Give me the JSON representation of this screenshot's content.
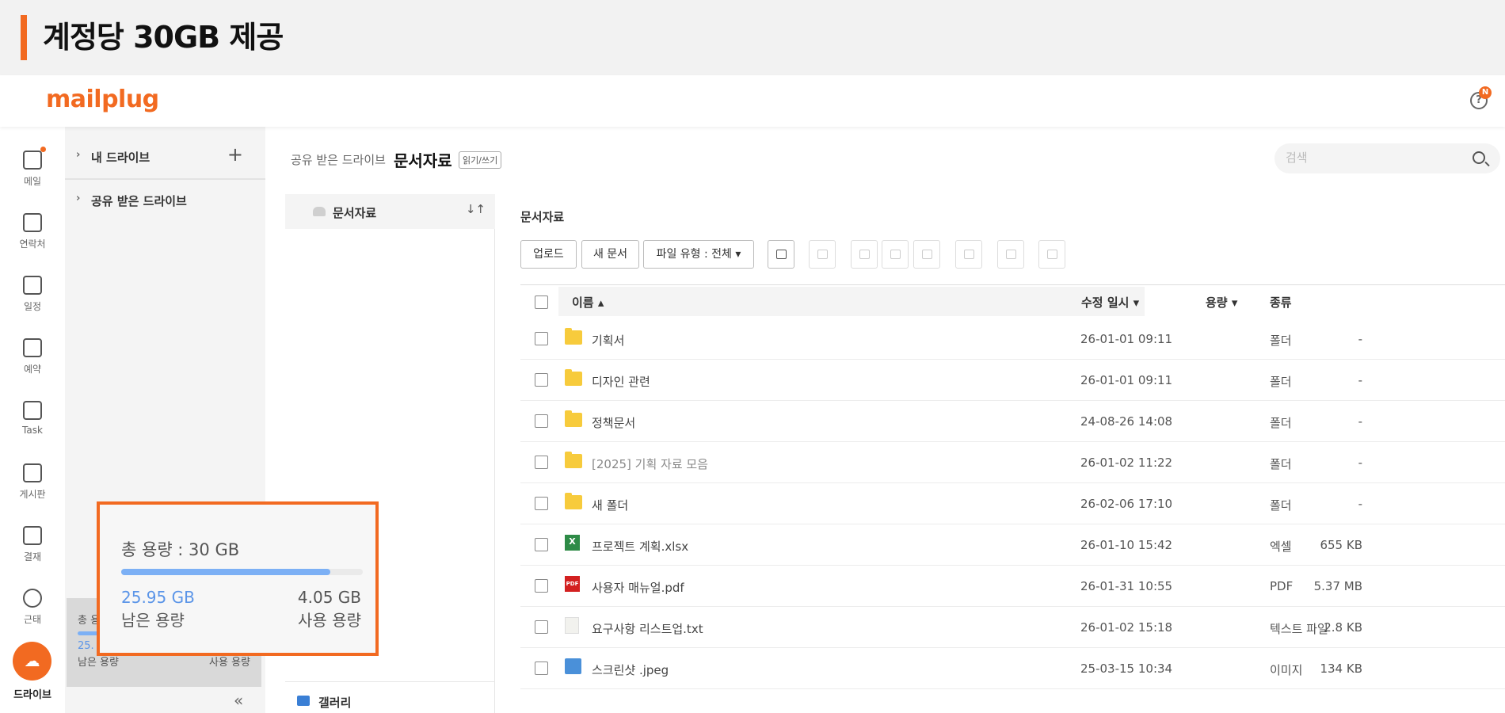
{
  "banner": {
    "title": "계정당 30GB 제공"
  },
  "header": {
    "logo": "mailplug",
    "help_symbol": "?",
    "help_badge": "N"
  },
  "rail": {
    "items": [
      {
        "label": "메일",
        "icon": "mail-icon"
      },
      {
        "label": "연락처",
        "icon": "contacts-icon"
      },
      {
        "label": "일정",
        "icon": "calendar-icon"
      },
      {
        "label": "예약",
        "icon": "reservation-icon"
      },
      {
        "label": "Task",
        "icon": "task-icon"
      },
      {
        "label": "게시판",
        "icon": "board-icon"
      },
      {
        "label": "결재",
        "icon": "approval-icon"
      },
      {
        "label": "근태",
        "icon": "attendance-icon"
      }
    ],
    "active": {
      "label": "드라이브",
      "icon": "cloud-drive-icon"
    }
  },
  "tree": {
    "my_drive": "내 드라이브",
    "shared_drive": "공유 받은 드라이브",
    "add_symbol": "+",
    "collapse_symbol": "«",
    "usage": {
      "total_label": "총 용",
      "remain_value": "25.",
      "remain_label": "남은 용량",
      "used_label": "사용 용량"
    }
  },
  "main": {
    "breadcrumb_parent": "공유 받은 드라이브",
    "breadcrumb_current": "문서자료",
    "permission": "읽기/쓰기",
    "search_placeholder": "검색",
    "folder_list": {
      "item": "문서자료",
      "sort_symbol": "↓↑",
      "gallery": "갤러리"
    },
    "area_title": "문서자료",
    "toolbar": {
      "upload": "업로드",
      "new_doc": "새 문서",
      "file_type": "파일 유형 : 전체 ▾"
    },
    "table": {
      "headers": {
        "name": "이름 ▴",
        "modified": "수정 일시 ▾",
        "size": "용량 ▾",
        "kind": "종류"
      },
      "rows": [
        {
          "type": "folder",
          "name": "기획서",
          "date": "26-01-01 09:11",
          "size": "-",
          "kind": "폴더"
        },
        {
          "type": "folder",
          "name": "디자인 관련",
          "date": "26-01-01 09:11",
          "size": "-",
          "kind": "폴더"
        },
        {
          "type": "folder",
          "name": "정책문서",
          "date": "24-08-26 14:08",
          "size": "-",
          "kind": "폴더"
        },
        {
          "type": "folder",
          "name": "[2025] 기획 자료 모음",
          "date": "26-01-02 11:22",
          "size": "-",
          "kind": "폴더"
        },
        {
          "type": "folder",
          "name": "새 폴더",
          "date": "26-02-06 17:10",
          "size": "-",
          "kind": "폴더"
        },
        {
          "type": "xlsx",
          "name": "프로젝트 계획.xlsx",
          "date": "26-01-10 15:42",
          "size": "655 KB",
          "kind": "엑셀"
        },
        {
          "type": "pdf",
          "name": "사용자 매뉴얼.pdf",
          "date": "26-01-31 10:55",
          "size": "5.37 MB",
          "kind": "PDF"
        },
        {
          "type": "txt",
          "name": "요구사항 리스트업.txt",
          "date": "26-01-02 15:18",
          "size": "2.8 KB",
          "kind": "텍스트 파일"
        },
        {
          "type": "img",
          "name": "스크린샷 .jpeg",
          "date": "25-03-15 10:34",
          "size": "134 KB",
          "kind": "이미지"
        }
      ]
    }
  },
  "usage_popup": {
    "total": "총 용량 : 30 GB",
    "remaining": "25.95 GB",
    "used": "4.05 GB",
    "remaining_label": "남은 용량",
    "used_label": "사용 용량",
    "used_fraction": 0.865
  },
  "colors": {
    "accent": "#f26a21",
    "bar_fill": "#7cb0f5",
    "remain_text": "#5b95e8"
  },
  "icon_glyphs": {
    "xlsx": "X",
    "pdf": "PDF"
  }
}
